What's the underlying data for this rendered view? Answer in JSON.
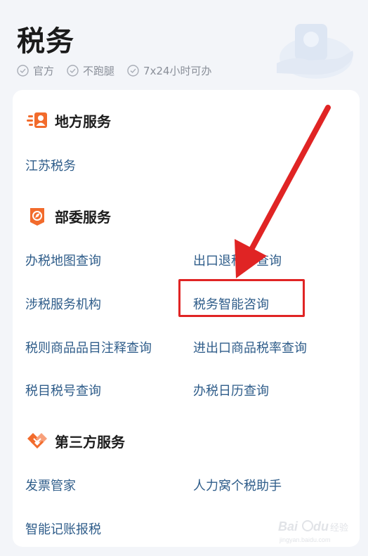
{
  "header": {
    "title": "税务",
    "tags": [
      "官方",
      "不跑腿",
      "7x24小时可办"
    ]
  },
  "sections": {
    "local": {
      "title": "地方服务",
      "links": [
        "江苏税务"
      ]
    },
    "ministry": {
      "title": "部委服务",
      "links": [
        "办税地图查询",
        "出口退税率查询",
        "涉税服务机构",
        "税务智能咨询",
        "税则商品品目注释查询",
        "进出口商品税率查询",
        "税目税号查询",
        "办税日历查询"
      ]
    },
    "third_party": {
      "title": "第三方服务",
      "links": [
        "发票管家",
        "人力窝个税助手",
        "智能记账报税"
      ]
    }
  },
  "annotation": {
    "highlight_color": "#e02424"
  },
  "watermark": {
    "brand": "Bai",
    "brand2": "du",
    "sub": "经验",
    "url": "jingyan.baidu.com"
  },
  "colors": {
    "accent_orange": "#f26b2c",
    "link_blue": "#2f5d8a"
  }
}
